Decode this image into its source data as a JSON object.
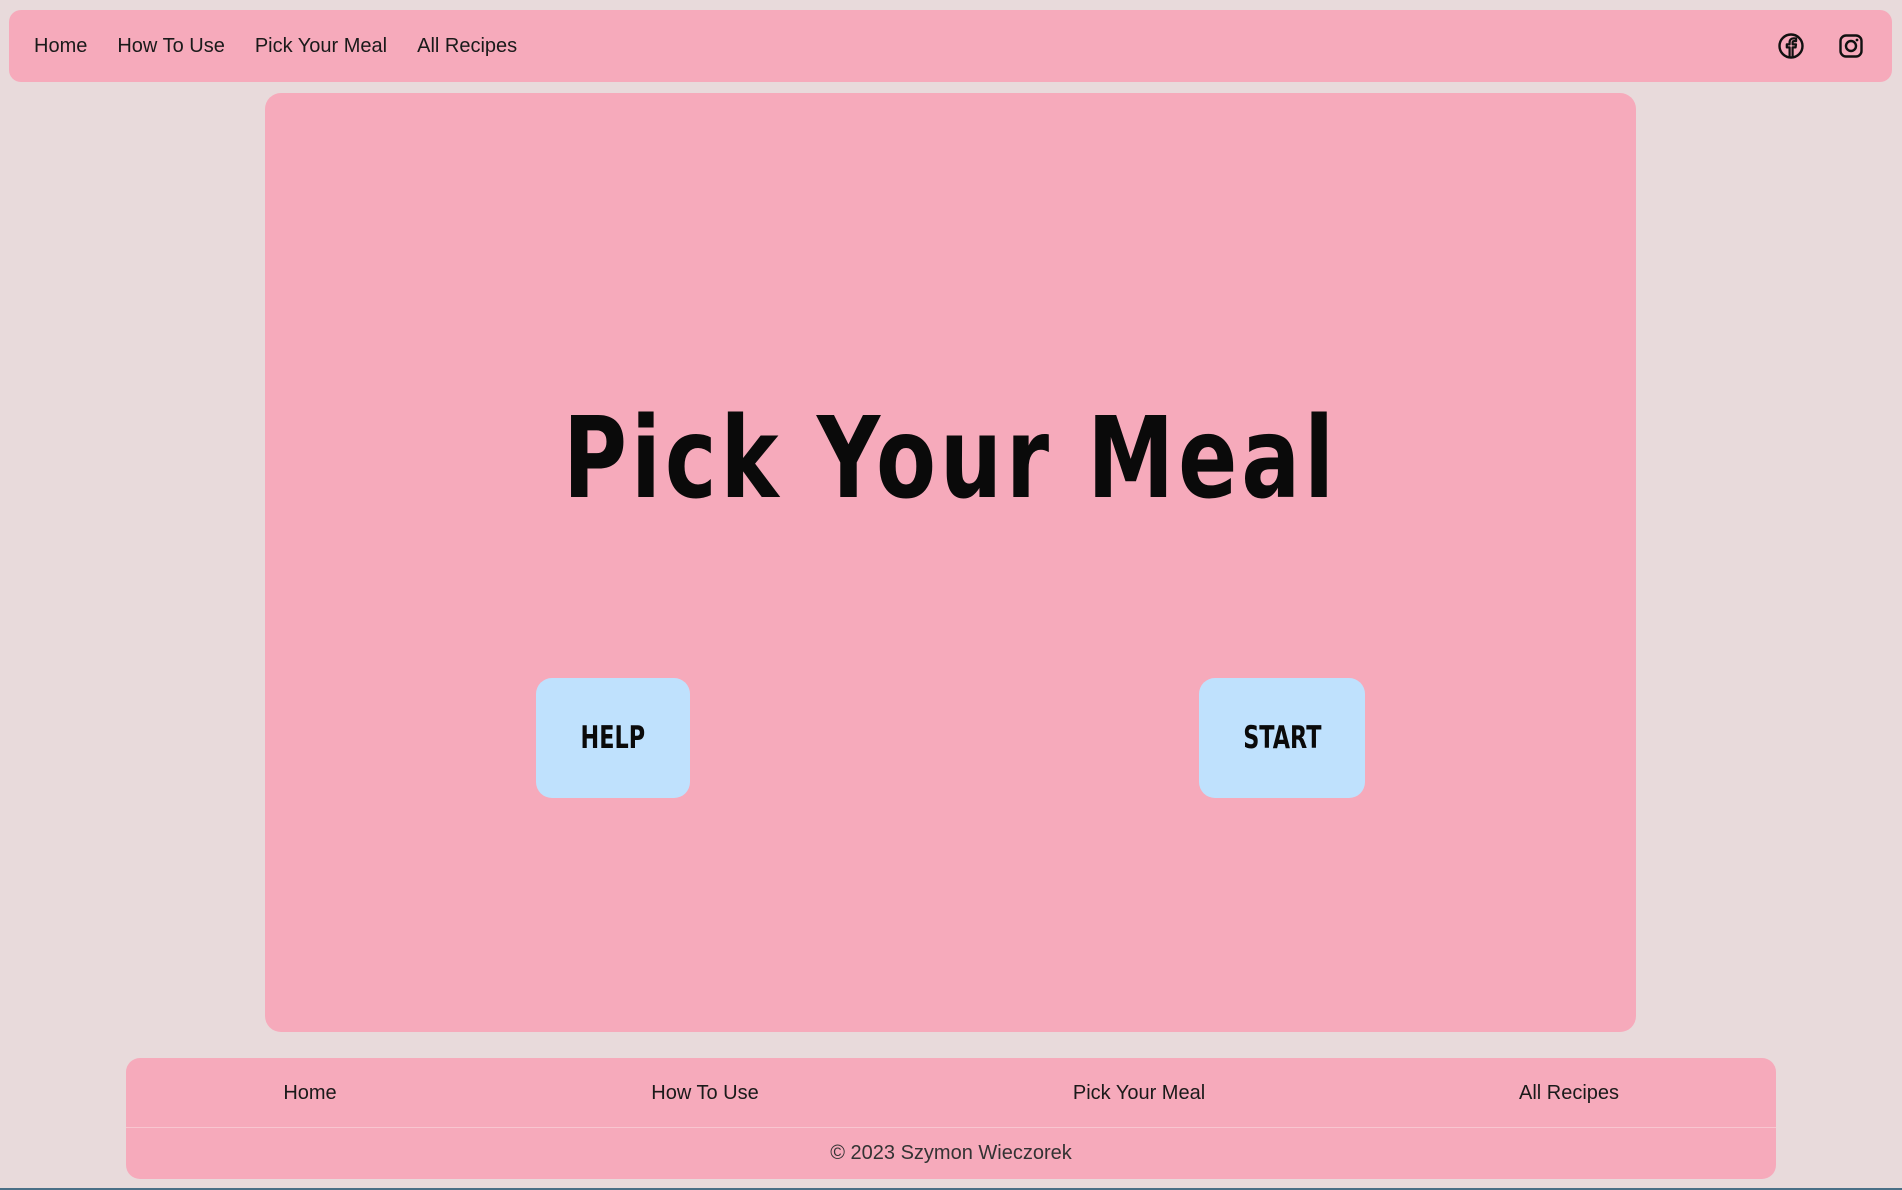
{
  "colors": {
    "background": "#e8dadb",
    "panel": "#f6aabb",
    "button": "#bfe1fd",
    "text": "#1a1a1a"
  },
  "topnav": {
    "links": [
      "Home",
      "How To Use",
      "Pick Your Meal",
      "All Recipes"
    ],
    "social_icons": [
      "facebook-icon",
      "instagram-icon"
    ]
  },
  "hero": {
    "title": "Pick Your Meal",
    "help_label": "HELP",
    "start_label": "START"
  },
  "footer": {
    "links": [
      "Home",
      "How To Use",
      "Pick Your Meal",
      "All Recipes"
    ],
    "copyright": "© 2023 Szymon Wieczorek"
  }
}
